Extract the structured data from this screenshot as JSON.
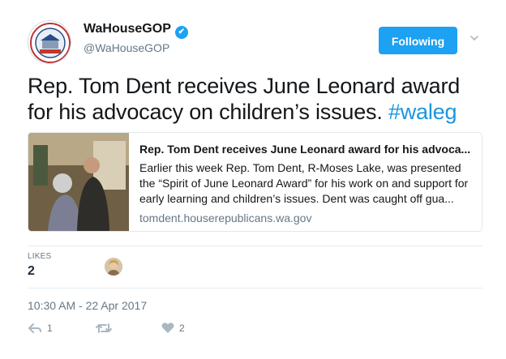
{
  "account": {
    "display_name": "WaHouseGOP",
    "verified_mark": "✔",
    "handle": "@WaHouseGOP",
    "avatar_icon": "house-republicans-seal"
  },
  "follow_button": {
    "label": "Following"
  },
  "tweet": {
    "text": "Rep. Tom Dent receives June Leonard award for his advocacy on children’s issues. ",
    "hashtag": "#waleg"
  },
  "card": {
    "title": "Rep. Tom Dent receives June Leonard award for his advoca...",
    "description": "Earlier this week Rep. Tom Dent, R-Moses Lake, was presented the “Spirit of June Leonard Award” for his work on and support for early learning and children’s issues. Dent was caught off gua...",
    "domain": "tomdent.houserepublicans.wa.gov"
  },
  "likes": {
    "label": "LIKES",
    "count": "2"
  },
  "timestamp": "10:30 AM - 22 Apr 2017",
  "actions": {
    "reply_count": "1",
    "retweet_count": "",
    "like_count": "2"
  },
  "colors": {
    "accent": "#1da1f2",
    "hashtag": "#1b95e0",
    "muted": "#657786"
  }
}
